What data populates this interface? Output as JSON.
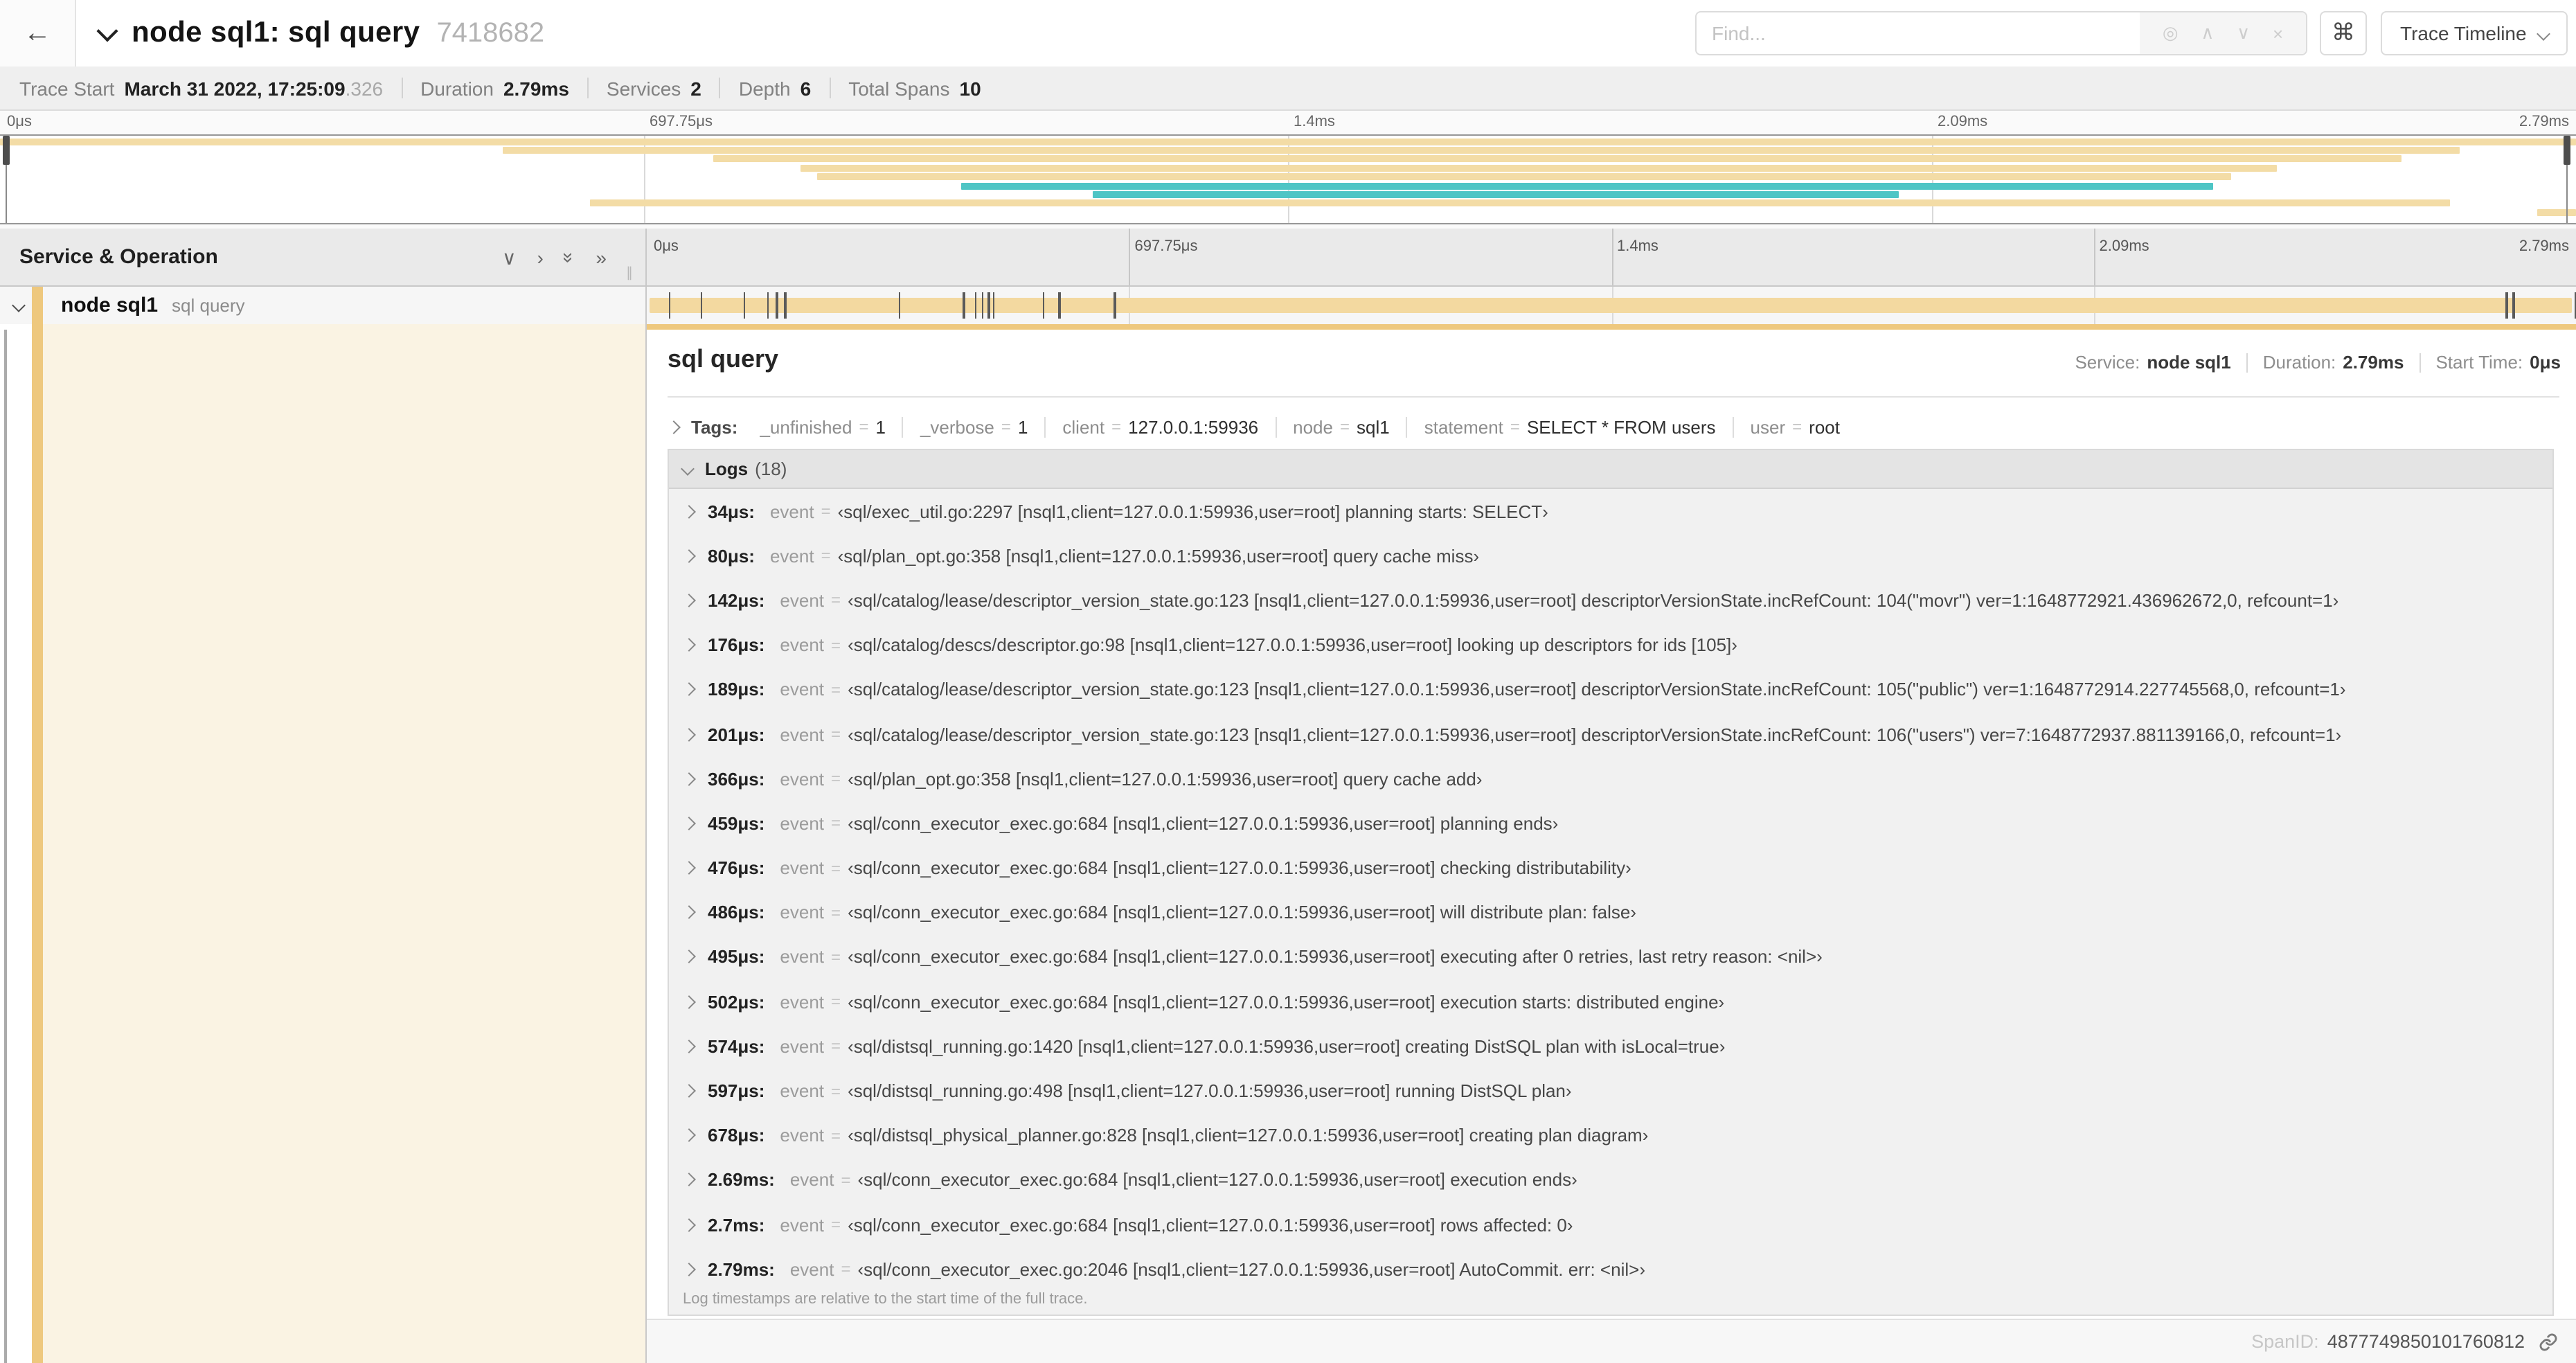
{
  "colors": {
    "tan": "#f3dca6",
    "tan_bar": "#f3d9a0",
    "accent": "#eec87e",
    "teal": "#4ec5c5",
    "cream": "#faf3e3"
  },
  "header": {
    "back": "←",
    "title": "node sql1: sql query",
    "trace_id": "7418682",
    "find_placeholder": "Find...",
    "shortcut": "⌘",
    "view_button": "Trace Timeline"
  },
  "trace_info": {
    "items": [
      {
        "label": "Trace Start",
        "value": "March 31 2022, 17:25:09",
        "suffix": ".326"
      },
      {
        "label": "Duration",
        "value": "2.79ms"
      },
      {
        "label": "Services",
        "value": "2"
      },
      {
        "label": "Depth",
        "value": "6"
      },
      {
        "label": "Total Spans",
        "value": "10"
      }
    ]
  },
  "axis": {
    "ticks": [
      {
        "text": "0μs",
        "pos": 0
      },
      {
        "text": "697.75μs",
        "pos": 0.25
      },
      {
        "text": "1.4ms",
        "pos": 0.5
      },
      {
        "text": "2.09ms",
        "pos": 0.75
      },
      {
        "text": "2.79ms",
        "pos": 1
      }
    ]
  },
  "minimap": {
    "spans": [
      {
        "s": 0,
        "e": 1,
        "c": "tan"
      },
      {
        "s": 0.195,
        "e": 0.955,
        "c": "tan"
      },
      {
        "s": 0.277,
        "e": 0.932,
        "c": "tan"
      },
      {
        "s": 0.311,
        "e": 0.884,
        "c": "tan"
      },
      {
        "s": 0.317,
        "e": 0.866,
        "c": "tan"
      },
      {
        "s": 0.373,
        "e": 0.859,
        "c": "teal"
      },
      {
        "s": 0.424,
        "e": 0.737,
        "c": "teal"
      },
      {
        "s": 0.229,
        "e": 0.951,
        "c": "tan"
      },
      {
        "s": 0.985,
        "e": 1,
        "c": "tan"
      }
    ]
  },
  "timeline_header": {
    "title": "Service & Operation"
  },
  "span_row": {
    "service": "node sql1",
    "operation": "sql query"
  },
  "detail": {
    "title": "sql query",
    "meta": [
      {
        "label": "Service:",
        "value": "node sql1"
      },
      {
        "label": "Duration:",
        "value": "2.79ms"
      },
      {
        "label": "Start Time:",
        "value": "0μs"
      }
    ],
    "tags_label": "Tags:",
    "tags": [
      {
        "key": "_unfinished",
        "value": "1"
      },
      {
        "key": "_verbose",
        "value": "1"
      },
      {
        "key": "client",
        "value": "127.0.0.1:59936"
      },
      {
        "key": "node",
        "value": "sql1"
      },
      {
        "key": "statement",
        "value": "SELECT * FROM users"
      },
      {
        "key": "user",
        "value": "root"
      }
    ],
    "logs_label": "Logs",
    "logs_count": "(18)",
    "logs": [
      {
        "ts": "34μs:",
        "frac": 0.0122,
        "key": "event",
        "value": "‹sql/exec_util.go:2297 [nsql1,client=127.0.0.1:59936,user=root] planning starts: SELECT›"
      },
      {
        "ts": "80μs:",
        "frac": 0.0287,
        "key": "event",
        "value": "‹sql/plan_opt.go:358 [nsql1,client=127.0.0.1:59936,user=root] query cache miss›"
      },
      {
        "ts": "142μs:",
        "frac": 0.0509,
        "key": "event",
        "value": "‹sql/catalog/lease/descriptor_version_state.go:123 [nsql1,client=127.0.0.1:59936,user=root] descriptorVersionState.incRefCount: 104(\"movr\") ver=1:1648772921.436962672,0, refcount=1›"
      },
      {
        "ts": "176μs:",
        "frac": 0.0631,
        "key": "event",
        "value": "‹sql/catalog/descs/descriptor.go:98 [nsql1,client=127.0.0.1:59936,user=root] looking up descriptors for ids [105]›"
      },
      {
        "ts": "189μs:",
        "frac": 0.0677,
        "key": "event",
        "value": "‹sql/catalog/lease/descriptor_version_state.go:123 [nsql1,client=127.0.0.1:59936,user=root] descriptorVersionState.incRefCount: 105(\"public\") ver=1:1648772914.227745568,0, refcount=1›"
      },
      {
        "ts": "201μs:",
        "frac": 0.072,
        "key": "event",
        "value": "‹sql/catalog/lease/descriptor_version_state.go:123 [nsql1,client=127.0.0.1:59936,user=root] descriptorVersionState.incRefCount: 106(\"users\") ver=7:1648772937.881139166,0, refcount=1›"
      },
      {
        "ts": "366μs:",
        "frac": 0.1312,
        "key": "event",
        "value": "‹sql/plan_opt.go:358 [nsql1,client=127.0.0.1:59936,user=root] query cache add›"
      },
      {
        "ts": "459μs:",
        "frac": 0.1645,
        "key": "event",
        "value": "‹sql/conn_executor_exec.go:684 [nsql1,client=127.0.0.1:59936,user=root] planning ends›"
      },
      {
        "ts": "476μs:",
        "frac": 0.1706,
        "key": "event",
        "value": "‹sql/conn_executor_exec.go:684 [nsql1,client=127.0.0.1:59936,user=root] checking distributability›"
      },
      {
        "ts": "486μs:",
        "frac": 0.1742,
        "key": "event",
        "value": "‹sql/conn_executor_exec.go:684 [nsql1,client=127.0.0.1:59936,user=root] will distribute plan: false›"
      },
      {
        "ts": "495μs:",
        "frac": 0.1774,
        "key": "event",
        "value": "‹sql/conn_executor_exec.go:684 [nsql1,client=127.0.0.1:59936,user=root] executing after 0 retries, last retry reason: <nil>›"
      },
      {
        "ts": "502μs:",
        "frac": 0.18,
        "key": "event",
        "value": "‹sql/conn_executor_exec.go:684 [nsql1,client=127.0.0.1:59936,user=root] execution starts: distributed engine›"
      },
      {
        "ts": "574μs:",
        "frac": 0.2057,
        "key": "event",
        "value": "‹sql/distsql_running.go:1420 [nsql1,client=127.0.0.1:59936,user=root] creating DistSQL plan with isLocal=true›"
      },
      {
        "ts": "597μs:",
        "frac": 0.214,
        "key": "event",
        "value": "‹sql/distsql_running.go:498 [nsql1,client=127.0.0.1:59936,user=root] running DistSQL plan›"
      },
      {
        "ts": "678μs:",
        "frac": 0.243,
        "key": "event",
        "value": "‹sql/distsql_physical_planner.go:828 [nsql1,client=127.0.0.1:59936,user=root] creating plan diagram›"
      },
      {
        "ts": "2.69ms:",
        "frac": 0.9642,
        "key": "event",
        "value": "‹sql/conn_executor_exec.go:684 [nsql1,client=127.0.0.1:59936,user=root] execution ends›"
      },
      {
        "ts": "2.7ms:",
        "frac": 0.9677,
        "key": "event",
        "value": "‹sql/conn_executor_exec.go:684 [nsql1,client=127.0.0.1:59936,user=root] rows affected: 0›"
      },
      {
        "ts": "2.79ms:",
        "frac": 1.0,
        "key": "event",
        "value": "‹sql/conn_executor_exec.go:2046 [nsql1,client=127.0.0.1:59936,user=root] AutoCommit. err: <nil>›"
      }
    ],
    "logs_note": "Log timestamps are relative to the start time of the full trace.",
    "footer": {
      "label": "SpanID:",
      "value": "4877749850101760812"
    }
  }
}
